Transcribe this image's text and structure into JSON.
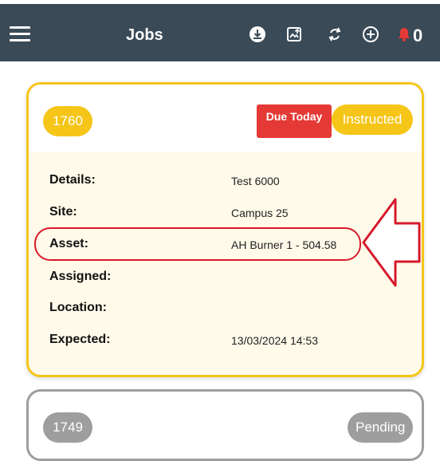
{
  "header": {
    "title": "Jobs",
    "notification_count": "0",
    "icons": [
      "menu-icon",
      "download-icon",
      "gallery-upload-icon",
      "sync-icon",
      "add-circle-icon",
      "bell-icon"
    ]
  },
  "jobs": [
    {
      "id": "1760",
      "due_label": "Due Today",
      "status": "Instructed",
      "fields": [
        {
          "label": "Details:",
          "value": "Test 6000"
        },
        {
          "label": "Site:",
          "value": "Campus 25"
        },
        {
          "label": "Asset:",
          "value": "AH Burner 1 - 504.58"
        },
        {
          "label": "Assigned:",
          "value": ""
        },
        {
          "label": "Location:",
          "value": ""
        },
        {
          "label": "Expected:",
          "value": "13/03/2024 14:53"
        }
      ]
    },
    {
      "id": "1749",
      "status": "Pending"
    }
  ],
  "colors": {
    "header_bg": "#3a4a57",
    "accent_yellow": "#f5c518",
    "due_red": "#e53935",
    "highlight_red": "#d7192c",
    "pending_grey": "#9e9e9e"
  }
}
